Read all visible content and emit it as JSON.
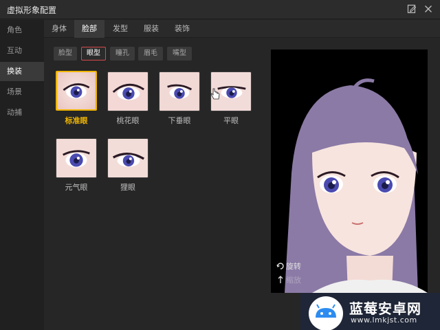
{
  "window": {
    "title": "虚拟形象配置",
    "edit_icon": "edit-icon",
    "close_icon": "close-icon"
  },
  "sidebar": {
    "items": [
      {
        "label": "角色"
      },
      {
        "label": "互动"
      },
      {
        "label": "换装",
        "active": true
      },
      {
        "label": "场景"
      },
      {
        "label": "动捕"
      }
    ]
  },
  "tabs": [
    {
      "label": "身体"
    },
    {
      "label": "脸部",
      "active": true
    },
    {
      "label": "发型"
    },
    {
      "label": "服装"
    },
    {
      "label": "装饰"
    }
  ],
  "subtabs": [
    {
      "label": "脸型"
    },
    {
      "label": "眼型",
      "active": true
    },
    {
      "label": "瞳孔"
    },
    {
      "label": "眉毛"
    },
    {
      "label": "嘴型"
    }
  ],
  "eye_options": [
    {
      "label": "标准眼",
      "selected": true
    },
    {
      "label": "桃花眼"
    },
    {
      "label": "下垂眼"
    },
    {
      "label": "平眼"
    },
    {
      "label": "元气眼"
    },
    {
      "label": "狸眼"
    }
  ],
  "preview": {
    "controls": [
      {
        "label": "旋转",
        "icon": "rotate-icon"
      },
      {
        "label": "缩放",
        "icon": "zoom-icon"
      }
    ]
  },
  "watermark": {
    "name": "蓝莓安卓网",
    "url": "www.lmkjst.com",
    "icon": "android-logo-icon"
  },
  "colors": {
    "selected_accent": "#f0b500",
    "subtab_active_border": "#d64a4a",
    "hair": "#8b7aa6",
    "iris": "#4a4ab0"
  }
}
